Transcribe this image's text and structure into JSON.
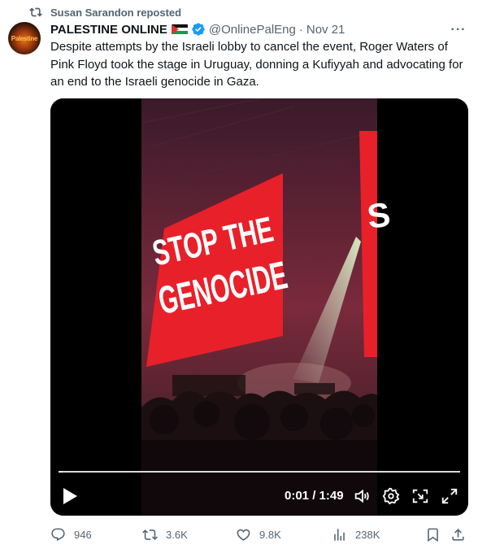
{
  "repost": {
    "text": "Susan Sarandon reposted",
    "icon": "repost-icon"
  },
  "tweet": {
    "avatar_text": "Palestine",
    "display_name": "PALESTINE ONLINE",
    "handle": "@OnlinePalEng",
    "separator": "·",
    "date": "Nov 21",
    "text": "Despite attempts by the Israeli lobby to cancel the event, Roger Waters of Pink Floyd took the stage in Uruguay, donning a Kufiyyah and advocating for an end to the Israeli genocide in Gaza."
  },
  "video": {
    "screen_text_line1": "STOP THE",
    "screen_text_line2": "GENOCIDE",
    "time_display": "0:01 / 1:49",
    "progress": 0.01
  },
  "actions": {
    "replies": "946",
    "reposts": "3.6K",
    "likes": "9.8K",
    "views": "238K"
  },
  "colors": {
    "text_primary": "#0f1419",
    "text_secondary": "#536471",
    "verified_blue": "#1d9bf0",
    "screen_red": "#e8202a"
  }
}
